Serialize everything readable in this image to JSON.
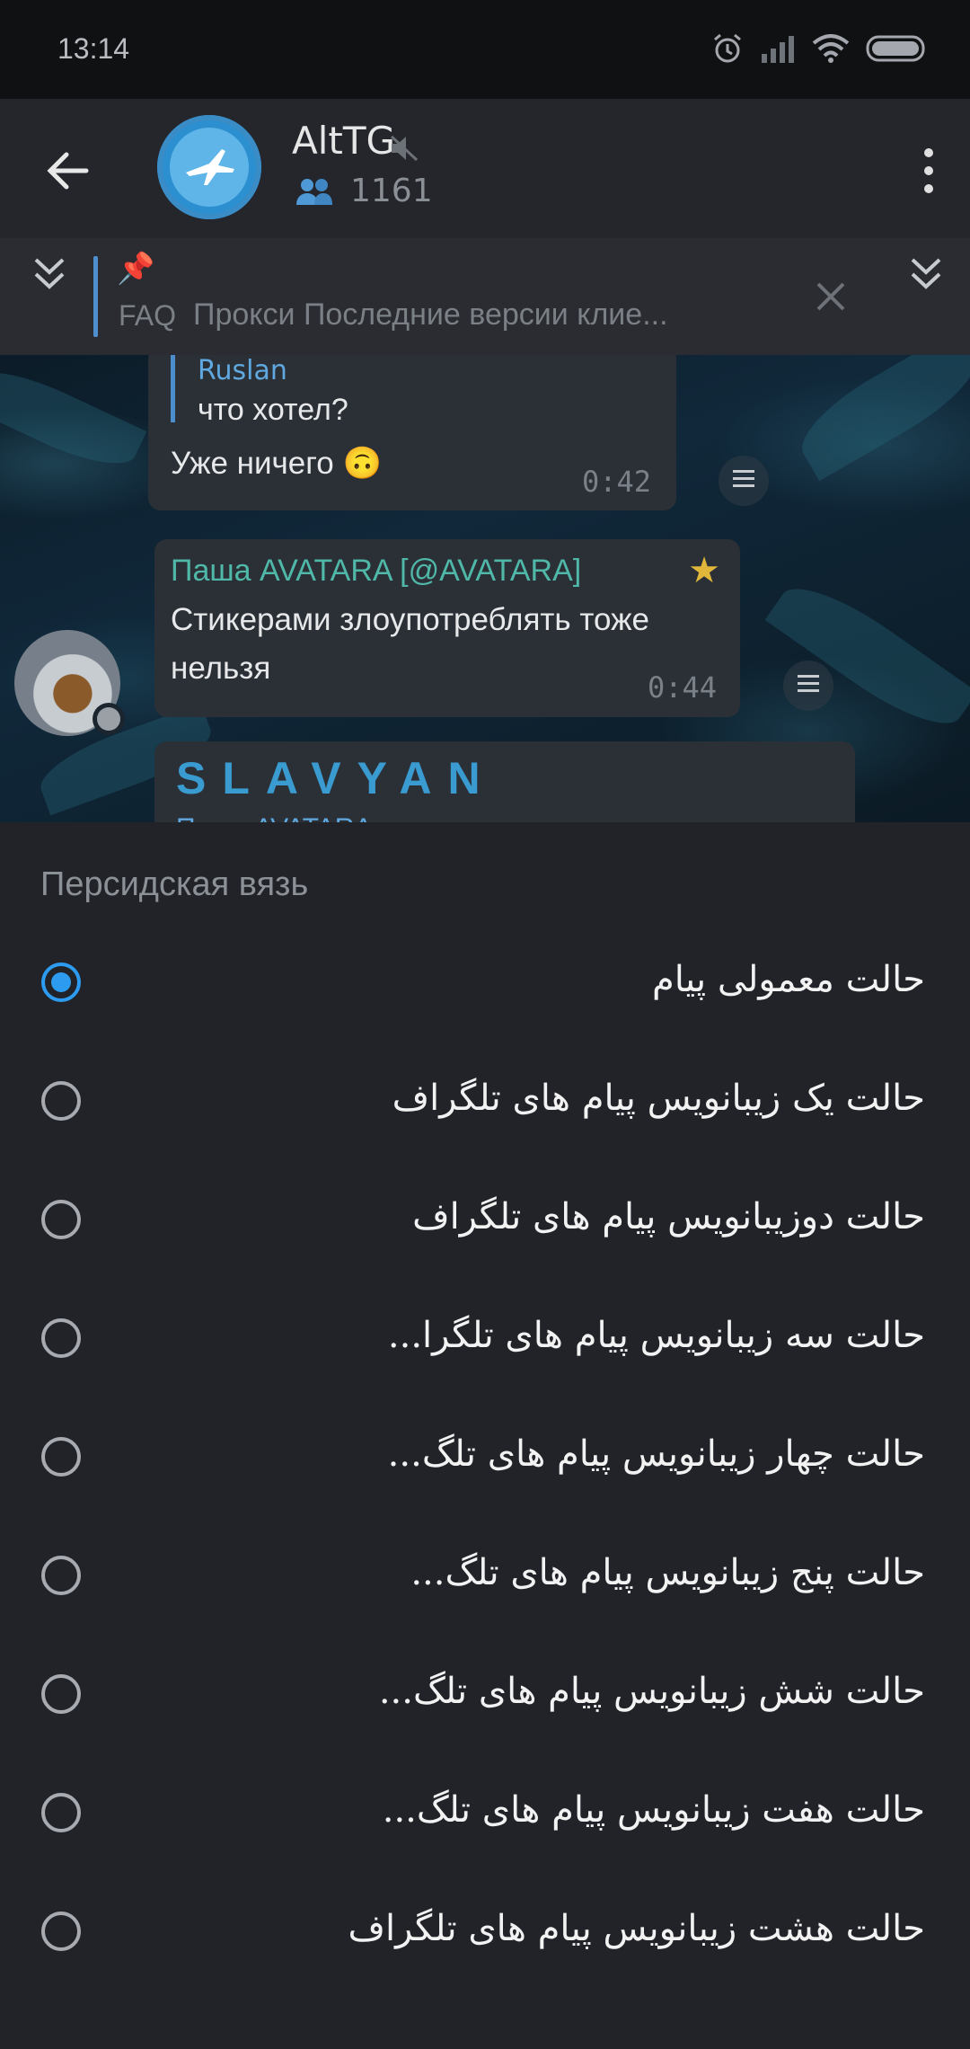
{
  "status": {
    "time": "13:14"
  },
  "header": {
    "title": "AltTG",
    "members": "1161"
  },
  "pinned": {
    "faq": "FAQ",
    "text": "Прокси    Последние версии клие..."
  },
  "messages": {
    "m1": {
      "reply_name": "Ruslan",
      "reply_text": "что хотел?",
      "text": "Уже ничего 🙃",
      "time": "0:42"
    },
    "m2": {
      "sender": "Паша AVATARA [@AVATARA]",
      "text1": "Стикерами злоупотреблять тоже",
      "text2": "нельзя",
      "time": "0:44"
    },
    "m3": {
      "title": "SLAVYAN",
      "reply_name": "Паша AVATARA"
    }
  },
  "sheet": {
    "title": "Персидская вязь",
    "options": [
      "حالت معمولی پیام",
      "حالت یک زیبانویس پیام های تلگراف",
      "حالت دوزیبانویس پیام های تلگراف",
      "حالت سه زیبانویس پیام های تلگرا...",
      "حالت چهار زیبانویس پیام های تلگ...",
      "حالت پنج زیبانویس پیام های تلگ...",
      "حالت شش زیبانویس پیام های تلگ...",
      "حالت هفت زیبانویس پیام های تلگ...",
      "حالت هشت زیبانویس پیام های تلگراف"
    ],
    "selected_index": 0
  },
  "colors": {
    "accent": "#2d9cf0",
    "sheet_bg": "#212329",
    "header_bg": "#24262b"
  }
}
